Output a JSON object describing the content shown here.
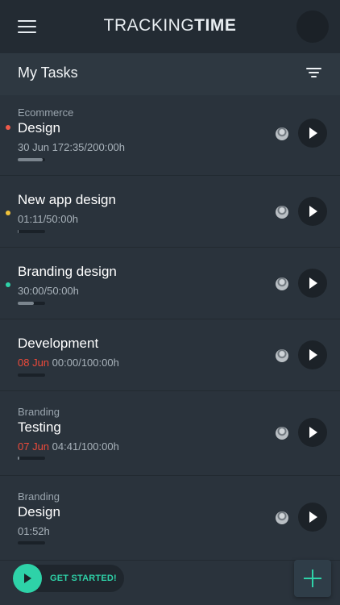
{
  "header": {
    "brand_light": "TRACKING",
    "brand_bold": "TIME"
  },
  "section": {
    "title": "My Tasks"
  },
  "tasks": [
    {
      "project": "Ecommerce",
      "name": "Design",
      "date": "",
      "time": "30 Jun 172:35/200:00h",
      "dot_color": "#ef5a4a",
      "progress": 0.9
    },
    {
      "project": "",
      "name": "New app design",
      "date": "",
      "time": "01:11/50:00h",
      "dot_color": "#f0c23a",
      "progress": 0.03
    },
    {
      "project": "",
      "name": "Branding design",
      "date": "",
      "time": "30:00/50:00h",
      "dot_color": "#2ed2a8",
      "progress": 0.6
    },
    {
      "project": "",
      "name": "Development",
      "date": "08 Jun",
      "time": "00:00/100:00h",
      "dot_color": "",
      "progress": 0
    },
    {
      "project": "Branding",
      "name": "Testing",
      "date": "07 Jun",
      "time": "04:41/100:00h",
      "dot_color": "",
      "progress": 0.05
    },
    {
      "project": "Branding",
      "name": "Design",
      "date": "",
      "time": "01:52h",
      "dot_color": "",
      "progress": 0
    }
  ],
  "cta": {
    "label": "GET STARTED!"
  },
  "colors": {
    "accent": "#2ed2a8",
    "background": "#2a333c",
    "header_bg": "#232b33",
    "overdue": "#ef4a3a"
  },
  "icons": {
    "menu": "hamburger-icon",
    "filter": "filter-icon",
    "play": "play-icon",
    "add": "plus-icon"
  }
}
